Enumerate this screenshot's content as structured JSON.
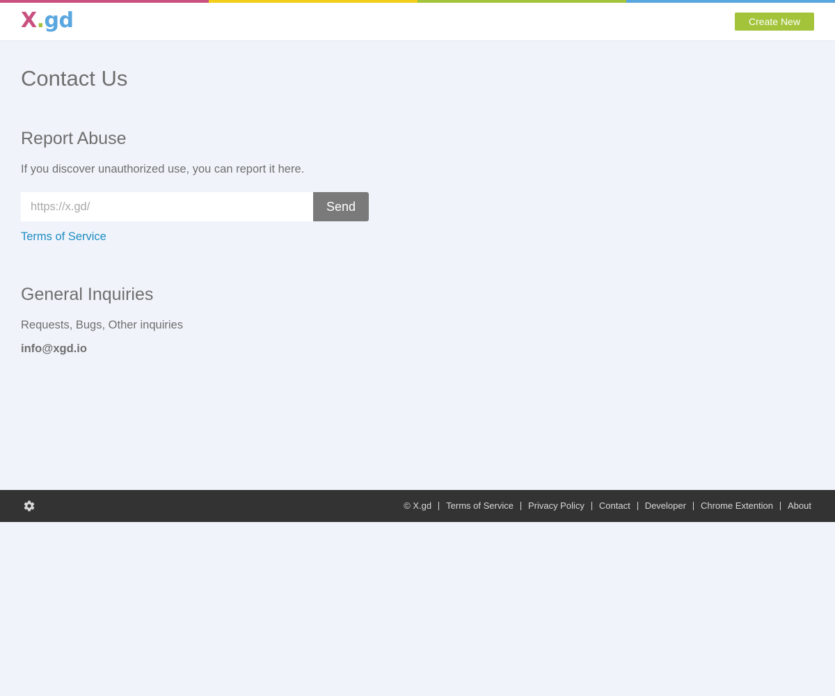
{
  "brand": {
    "logo_x": "X",
    "logo_dot": ".",
    "logo_gd": "gd",
    "colors": {
      "pink": "#c9517f",
      "yellow": "#f2cd1a",
      "green": "#a3c43a",
      "blue": "#5aa7df"
    }
  },
  "header": {
    "create_label": "Create New",
    "create_color": "#a3c43a"
  },
  "main": {
    "title": "Contact Us",
    "report": {
      "heading": "Report Abuse",
      "description": "If you discover unauthorized use, you can report it here.",
      "input_placeholder": "https://x.gd/",
      "input_value": "",
      "send_label": "Send",
      "tos_link": "Terms of Service"
    },
    "general": {
      "heading": "General Inquiries",
      "description": "Requests, Bugs, Other inquiries",
      "email": "info@xgd.io"
    }
  },
  "footer": {
    "settings_icon": "gear-icon",
    "copyright": "© X.gd",
    "links": [
      "Terms of Service",
      "Privacy Policy",
      "Contact",
      "Developer",
      "Chrome Extention",
      "About"
    ]
  }
}
